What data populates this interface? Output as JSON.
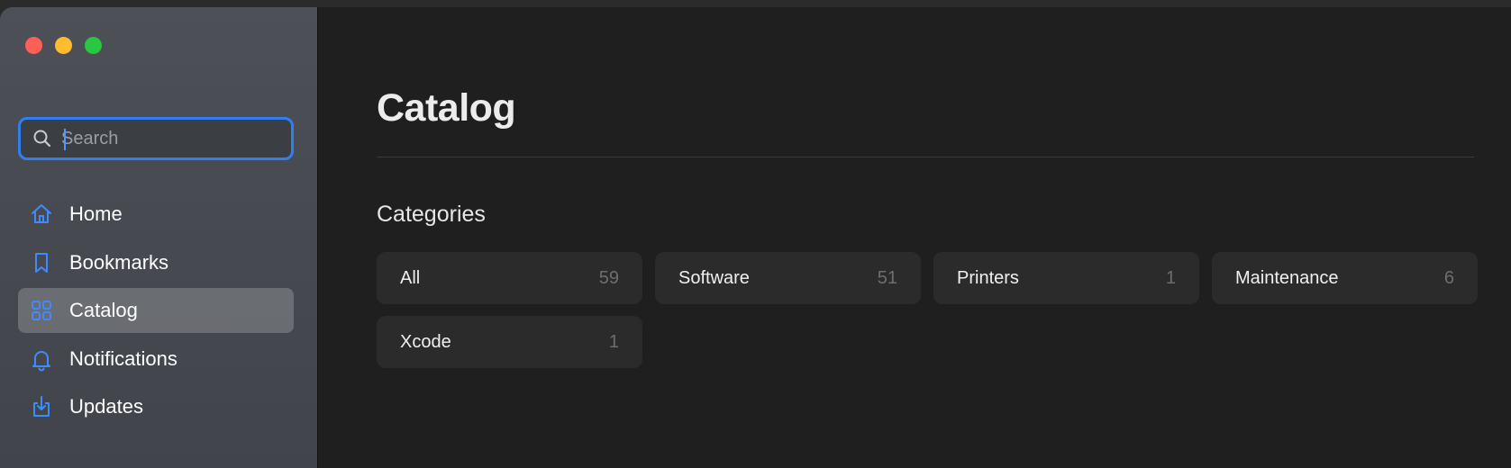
{
  "window": {
    "controls": {
      "close_color": "#fe5f57",
      "minimize_color": "#febc2e",
      "zoom_color": "#28c840"
    }
  },
  "sidebar": {
    "search": {
      "placeholder": "Search",
      "value": "",
      "icon": "magnifying-glass-icon"
    },
    "items": [
      {
        "label": "Home",
        "icon": "house-icon",
        "selected": false
      },
      {
        "label": "Bookmarks",
        "icon": "bookmark-icon",
        "selected": false
      },
      {
        "label": "Catalog",
        "icon": "grid-icon",
        "selected": true
      },
      {
        "label": "Notifications",
        "icon": "bell-icon",
        "selected": false
      },
      {
        "label": "Updates",
        "icon": "download-tray-icon",
        "selected": false
      }
    ],
    "accent_color": "#2f7ff0"
  },
  "main": {
    "title": "Catalog",
    "section_title": "Categories",
    "categories": [
      {
        "name": "All",
        "count": "59"
      },
      {
        "name": "Software",
        "count": "51"
      },
      {
        "name": "Printers",
        "count": "1"
      },
      {
        "name": "Maintenance",
        "count": "6"
      },
      {
        "name": "Xcode",
        "count": "1"
      }
    ]
  }
}
